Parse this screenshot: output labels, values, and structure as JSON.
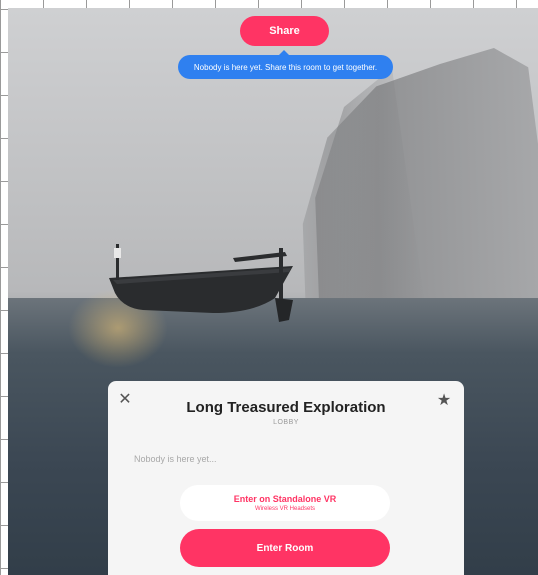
{
  "header": {
    "share_label": "Share",
    "share_tooltip": "Nobody is here yet. Share this room to get together."
  },
  "lobby": {
    "title": "Long Treasured Exploration",
    "subtitle": "LOBBY",
    "empty_message": "Nobody is here yet...",
    "standalone": {
      "label": "Enter on Standalone VR",
      "sublabel": "Wireless VR Headsets"
    },
    "enter_label": "Enter Room",
    "close_icon": "close-icon",
    "favorite_icon": "star-icon"
  },
  "colors": {
    "accent": "#ff3464",
    "tooltip": "#2f80f0",
    "panel": "#f5f5f5"
  }
}
